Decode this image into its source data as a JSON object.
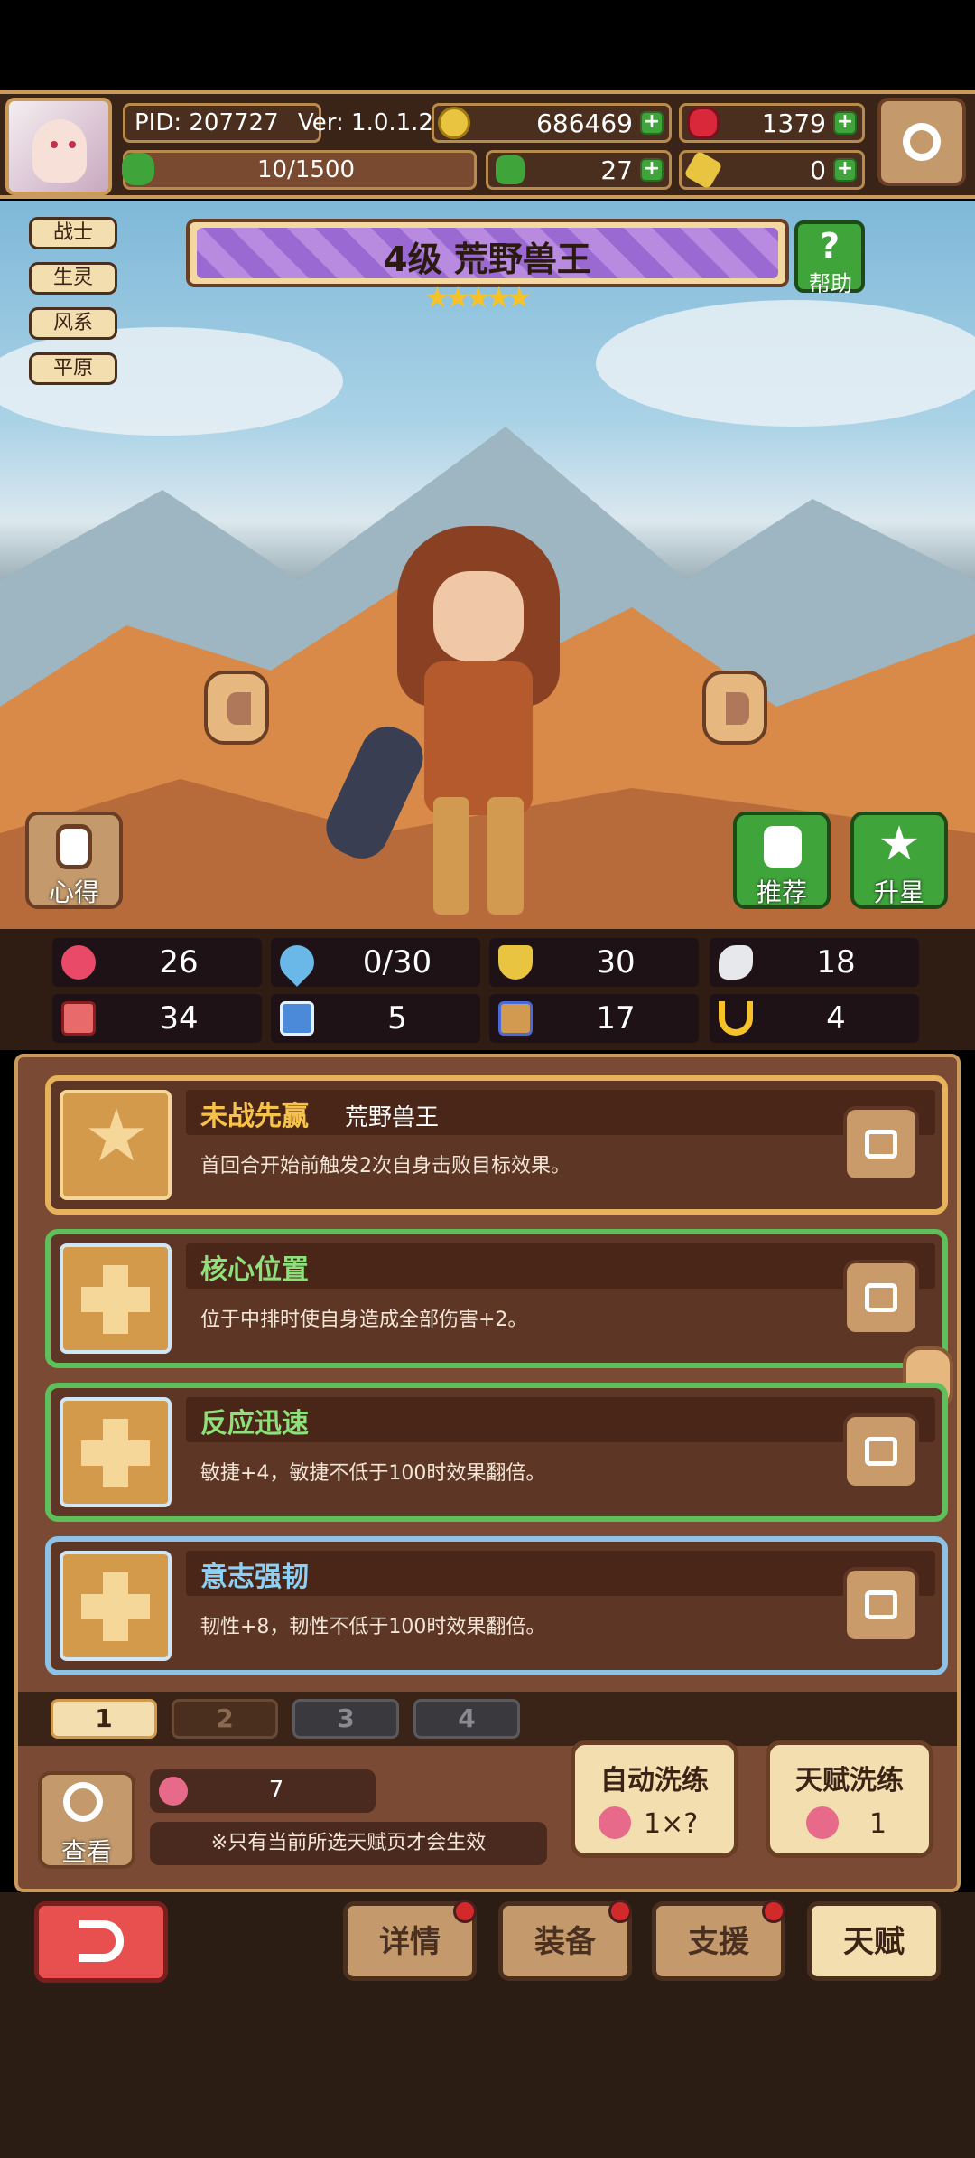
{
  "header": {
    "pid": "PID: 207727",
    "version": "Ver: 1.0.1.2",
    "gold": "686469",
    "gems": "1379",
    "stamina": "10/1500",
    "clover": "27",
    "keys": "0"
  },
  "hero": {
    "title": "4级  荒野兽王",
    "stars": 5,
    "help_label": "帮助",
    "tags": [
      "战士",
      "生灵",
      "风系",
      "平原"
    ],
    "left_btn": "心得",
    "recommend_btn": "推荐",
    "upgrade_btn": "升星"
  },
  "stats": {
    "hp": "26",
    "mana": "0/30",
    "shield": "30",
    "wing": "18",
    "attack": "34",
    "book": "5",
    "speed": "17",
    "magnet": "4"
  },
  "talents": [
    {
      "name": "未战先赢",
      "extra": "荒野兽王",
      "desc": "首回合开始前触发2次自身击败目标效果。",
      "border": "#e7b25a"
    },
    {
      "name": "核心位置",
      "extra": "",
      "desc": "位于中排时使自身造成全部伤害+2。",
      "border": "#5fbf5a"
    },
    {
      "name": "反应迅速",
      "extra": "",
      "desc": "敏捷+4，敏捷不低于100时效果翻倍。",
      "border": "#5fbf5a"
    },
    {
      "name": "意志强韧",
      "extra": "",
      "desc": "韧性+8，韧性不低于100时效果翻倍。",
      "border": "#8cc2e6"
    }
  ],
  "pages": [
    "1",
    "2",
    "3",
    "4"
  ],
  "bottom": {
    "view": "查看",
    "fruit_count": "7",
    "note": "※只有当前所选天赋页才会生效",
    "auto_refine": "自动洗练",
    "auto_cost": "1×?",
    "talent_refine": "天赋洗练",
    "talent_cost": "1"
  },
  "nav": {
    "detail": "详情",
    "equip": "装备",
    "support": "支援",
    "talent": "天赋"
  }
}
